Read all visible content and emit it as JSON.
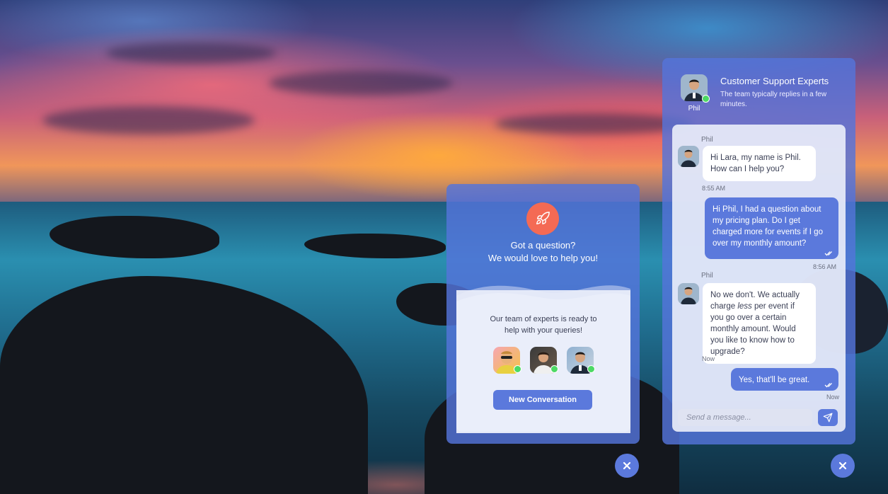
{
  "left_widget": {
    "heading_line1": "Got a question?",
    "heading_line2": "We would love to help you!",
    "experts_line1": "Our team of experts is ready to",
    "experts_line2": "help with your queries!",
    "new_conversation_label": "New Conversation",
    "expert_avatars": [
      "expert-1",
      "expert-2",
      "expert-3"
    ]
  },
  "right_widget": {
    "agent_name": "Phil",
    "header_title": "Customer Support Experts",
    "header_subtitle": "The team typically replies in a few minutes.",
    "messages": [
      {
        "sender": "Phil",
        "direction": "in",
        "text": "Hi Lara, my name is Phil. How can I help you?",
        "time": "8:55 AM"
      },
      {
        "sender": "",
        "direction": "out",
        "text": "Hi Phil, I had a question about my pricing plan. Do I get charged more for events if I go over my monthly amount?",
        "time": "8:56 AM"
      },
      {
        "sender": "Phil",
        "direction": "in",
        "text_before": "No we don't. We actually charge ",
        "text_em": "less",
        "text_after": " per event if you go over a certain monthly amount. Would you like to know how to upgrade?",
        "time": "Now"
      },
      {
        "sender": "",
        "direction": "out",
        "text": "Yes, that'll be great.",
        "time": "Now"
      }
    ],
    "input_placeholder": "Send a message..."
  },
  "colors": {
    "panel": "#5474db",
    "accent": "#5b79dc",
    "rocket": "#f46a54",
    "online": "#4cd964"
  },
  "icons": [
    "rocket-icon",
    "close-icon",
    "send-icon",
    "double-check-icon"
  ]
}
